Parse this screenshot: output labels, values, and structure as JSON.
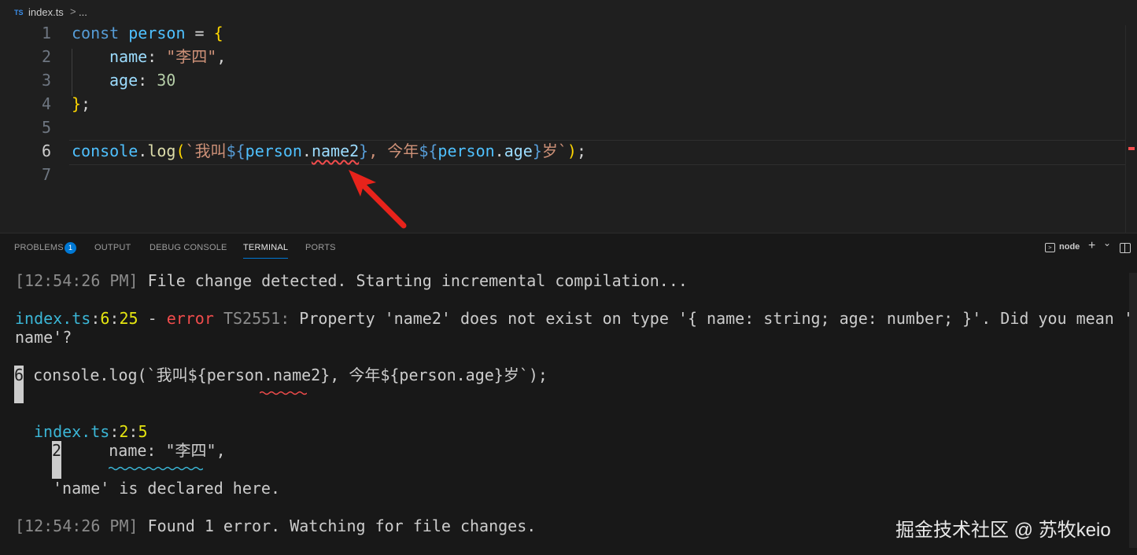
{
  "breadcrumb": {
    "ts_icon": "TS",
    "file": "index.ts",
    "separator": ">",
    "more": "..."
  },
  "editor": {
    "line_numbers": [
      "1",
      "2",
      "3",
      "4",
      "5",
      "6",
      "7"
    ],
    "active_line": "6",
    "lines": {
      "l1": {
        "kw": "const",
        "var": "person",
        "eq": " = ",
        "brace": "{"
      },
      "l2": {
        "prop": "name",
        "colon": ": ",
        "str": "\"李四\"",
        "comma": ","
      },
      "l3": {
        "prop": "age",
        "colon": ": ",
        "num": "30"
      },
      "l4": {
        "brace": "}",
        "semi": ";"
      },
      "l6": {
        "obj": "console",
        "dot": ".",
        "fn": "log",
        "paren_open": "(",
        "tick": "`",
        "text1": "我叫",
        "interp_open": "${",
        "var1": "person",
        "dot1": ".",
        "prop1": "name2",
        "interp_close": "}",
        "text2": ", 今年",
        "interp_open2": "${",
        "var2": "person",
        "dot2": ".",
        "prop2": "age",
        "interp_close2": "}",
        "text3": "岁",
        "tick2": "`",
        "paren_close": ")",
        "semi": ";"
      }
    },
    "error_color": "#f14c4c",
    "annotation_arrow_color": "#e8231b"
  },
  "panel": {
    "tabs": [
      {
        "label": "PROBLEMS",
        "active": false
      },
      {
        "label": "OUTPUT",
        "active": false
      },
      {
        "label": "DEBUG CONSOLE",
        "active": false
      },
      {
        "label": "TERMINAL",
        "active": true
      },
      {
        "label": "PORTS",
        "active": false
      }
    ],
    "problems_count": "1",
    "terminal_name": "node",
    "add_icon": "+",
    "dropdown_icon": "⌄",
    "terminal_icon": "terminal-icon",
    "split_icon": "split-panel-icon",
    "accent": "#0078d4"
  },
  "terminal": {
    "line1": {
      "ts": "[12:54:26 PM]",
      "msg": " File change detected. Starting incremental compilation..."
    },
    "line2": {
      "file": "index.ts",
      "c1": ":",
      "l": "6",
      "c2": ":",
      "col": "25",
      "dash": " - ",
      "error": "error",
      "code": " TS2551:",
      "msg": " Property 'name2' does not exist on type '{ name: string; age: number; }'. Did you mean '"
    },
    "line2b": "name'?",
    "line3": {
      "num": "6",
      "code": " console.log(`我叫${person.name2}, 今年${person.age}岁`);"
    },
    "line4": {
      "file": "index.ts",
      "c1": ":",
      "l": "2",
      "c2": ":",
      "col": "5"
    },
    "line5": {
      "num": "2",
      "code": "     name: \"李四\","
    },
    "line6": "'name' is declared here.",
    "line7": {
      "ts": "[12:54:26 PM]",
      "msg": " Found 1 error. Watching for file changes."
    }
  },
  "watermark": "掘金技术社区 @ 苏牧keio"
}
